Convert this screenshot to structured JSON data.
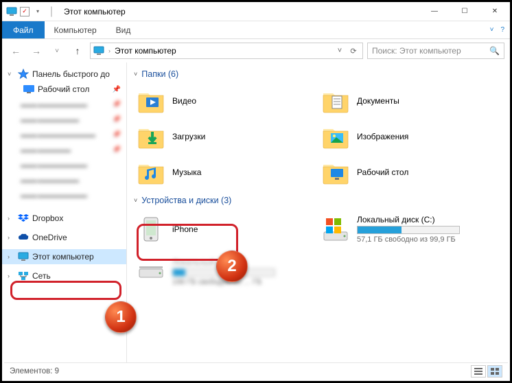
{
  "title": "Этот компьютер",
  "qat": {
    "save_checked": true
  },
  "window_buttons": {
    "min": "—",
    "max": "☐",
    "close": "✕"
  },
  "ribbon": {
    "file": "Файл",
    "tabs": [
      "Компьютер",
      "Вид"
    ],
    "help": "?"
  },
  "nav": {
    "back": "←",
    "fwd": "→",
    "recent": "˅",
    "up": "↑"
  },
  "address": {
    "root_icon": "monitor",
    "sep": "›",
    "location": "Этот компьютер",
    "dropdown": "˅",
    "refresh": "⟳"
  },
  "search": {
    "placeholder": "Поиск: Этот компьютер",
    "icon": "🔍"
  },
  "tree": {
    "quick": {
      "label": "Панель быстрого до",
      "chev": "˅"
    },
    "desktop": {
      "label": "Рабочий стол"
    },
    "blurred_count": 6,
    "dropbox": {
      "label": "Dropbox",
      "chev": "›"
    },
    "onedrive": {
      "label": "OneDrive",
      "chev": "›"
    },
    "thispc": {
      "label": "Этот компьютер",
      "chev": "›"
    },
    "network": {
      "label": "Сеть",
      "chev": "›"
    }
  },
  "groups": {
    "folders": {
      "title": "Папки (6)",
      "items": [
        {
          "name": "Видео",
          "overlay": "video"
        },
        {
          "name": "Документы",
          "overlay": "doc"
        },
        {
          "name": "Загрузки",
          "overlay": "download"
        },
        {
          "name": "Изображения",
          "overlay": "image"
        },
        {
          "name": "Музыка",
          "overlay": "music"
        },
        {
          "name": "Рабочий стол",
          "overlay": "desktop"
        }
      ]
    },
    "devices": {
      "title": "Устройства и диски (3)",
      "items": [
        {
          "name": "iPhone",
          "kind": "phone"
        },
        {
          "name": "Локальный диск (C:)",
          "kind": "os-drive",
          "free_text": "57,1 ГБ свободно из 99,9 ГБ",
          "fill_pct": 43
        },
        {
          "name": "Локальный диск",
          "kind": "drive",
          "free_text": "196 ГБ свободно из … ГБ",
          "fill_pct": 12,
          "blurred": true
        }
      ]
    }
  },
  "status": {
    "text": "Элементов: 9"
  },
  "annotations": {
    "n1": "1",
    "n2": "2"
  }
}
